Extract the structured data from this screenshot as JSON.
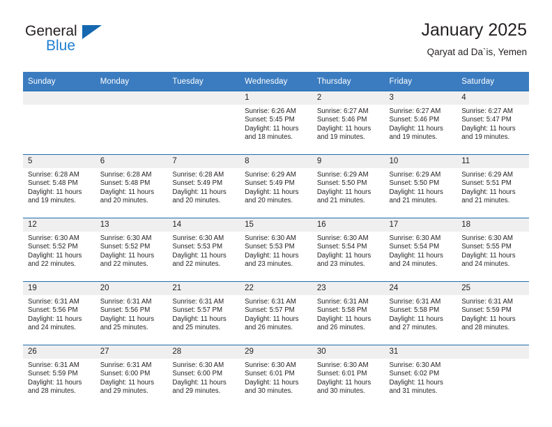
{
  "brand": {
    "name_top": "General",
    "name_bottom": "Blue",
    "flag_icon": "triangle-flag-icon",
    "accent_color": "#1567b0"
  },
  "header": {
    "title": "January 2025",
    "location": "Qaryat ad Da`is, Yemen"
  },
  "table": {
    "header_bg": "#3b7cc0",
    "row_divider_color": "#1f6cb0",
    "daynum_band_bg": "#efefef",
    "weekday_headers": [
      "Sunday",
      "Monday",
      "Tuesday",
      "Wednesday",
      "Thursday",
      "Friday",
      "Saturday"
    ],
    "labels": {
      "sunrise": "Sunrise:",
      "sunset": "Sunset:",
      "daylight": "Daylight:"
    },
    "weeks": [
      [
        {
          "day": "",
          "blank": true
        },
        {
          "day": "",
          "blank": true
        },
        {
          "day": "",
          "blank": true
        },
        {
          "day": "1",
          "sunrise": "Sunrise: 6:26 AM",
          "sunset": "Sunset: 5:45 PM",
          "daylight_line1": "Daylight: 11 hours",
          "daylight_line2": "and 18 minutes."
        },
        {
          "day": "2",
          "sunrise": "Sunrise: 6:27 AM",
          "sunset": "Sunset: 5:46 PM",
          "daylight_line1": "Daylight: 11 hours",
          "daylight_line2": "and 19 minutes."
        },
        {
          "day": "3",
          "sunrise": "Sunrise: 6:27 AM",
          "sunset": "Sunset: 5:46 PM",
          "daylight_line1": "Daylight: 11 hours",
          "daylight_line2": "and 19 minutes."
        },
        {
          "day": "4",
          "sunrise": "Sunrise: 6:27 AM",
          "sunset": "Sunset: 5:47 PM",
          "daylight_line1": "Daylight: 11 hours",
          "daylight_line2": "and 19 minutes."
        }
      ],
      [
        {
          "day": "5",
          "sunrise": "Sunrise: 6:28 AM",
          "sunset": "Sunset: 5:48 PM",
          "daylight_line1": "Daylight: 11 hours",
          "daylight_line2": "and 19 minutes."
        },
        {
          "day": "6",
          "sunrise": "Sunrise: 6:28 AM",
          "sunset": "Sunset: 5:48 PM",
          "daylight_line1": "Daylight: 11 hours",
          "daylight_line2": "and 20 minutes."
        },
        {
          "day": "7",
          "sunrise": "Sunrise: 6:28 AM",
          "sunset": "Sunset: 5:49 PM",
          "daylight_line1": "Daylight: 11 hours",
          "daylight_line2": "and 20 minutes."
        },
        {
          "day": "8",
          "sunrise": "Sunrise: 6:29 AM",
          "sunset": "Sunset: 5:49 PM",
          "daylight_line1": "Daylight: 11 hours",
          "daylight_line2": "and 20 minutes."
        },
        {
          "day": "9",
          "sunrise": "Sunrise: 6:29 AM",
          "sunset": "Sunset: 5:50 PM",
          "daylight_line1": "Daylight: 11 hours",
          "daylight_line2": "and 21 minutes."
        },
        {
          "day": "10",
          "sunrise": "Sunrise: 6:29 AM",
          "sunset": "Sunset: 5:50 PM",
          "daylight_line1": "Daylight: 11 hours",
          "daylight_line2": "and 21 minutes."
        },
        {
          "day": "11",
          "sunrise": "Sunrise: 6:29 AM",
          "sunset": "Sunset: 5:51 PM",
          "daylight_line1": "Daylight: 11 hours",
          "daylight_line2": "and 21 minutes."
        }
      ],
      [
        {
          "day": "12",
          "sunrise": "Sunrise: 6:30 AM",
          "sunset": "Sunset: 5:52 PM",
          "daylight_line1": "Daylight: 11 hours",
          "daylight_line2": "and 22 minutes."
        },
        {
          "day": "13",
          "sunrise": "Sunrise: 6:30 AM",
          "sunset": "Sunset: 5:52 PM",
          "daylight_line1": "Daylight: 11 hours",
          "daylight_line2": "and 22 minutes."
        },
        {
          "day": "14",
          "sunrise": "Sunrise: 6:30 AM",
          "sunset": "Sunset: 5:53 PM",
          "daylight_line1": "Daylight: 11 hours",
          "daylight_line2": "and 22 minutes."
        },
        {
          "day": "15",
          "sunrise": "Sunrise: 6:30 AM",
          "sunset": "Sunset: 5:53 PM",
          "daylight_line1": "Daylight: 11 hours",
          "daylight_line2": "and 23 minutes."
        },
        {
          "day": "16",
          "sunrise": "Sunrise: 6:30 AM",
          "sunset": "Sunset: 5:54 PM",
          "daylight_line1": "Daylight: 11 hours",
          "daylight_line2": "and 23 minutes."
        },
        {
          "day": "17",
          "sunrise": "Sunrise: 6:30 AM",
          "sunset": "Sunset: 5:54 PM",
          "daylight_line1": "Daylight: 11 hours",
          "daylight_line2": "and 24 minutes."
        },
        {
          "day": "18",
          "sunrise": "Sunrise: 6:30 AM",
          "sunset": "Sunset: 5:55 PM",
          "daylight_line1": "Daylight: 11 hours",
          "daylight_line2": "and 24 minutes."
        }
      ],
      [
        {
          "day": "19",
          "sunrise": "Sunrise: 6:31 AM",
          "sunset": "Sunset: 5:56 PM",
          "daylight_line1": "Daylight: 11 hours",
          "daylight_line2": "and 24 minutes."
        },
        {
          "day": "20",
          "sunrise": "Sunrise: 6:31 AM",
          "sunset": "Sunset: 5:56 PM",
          "daylight_line1": "Daylight: 11 hours",
          "daylight_line2": "and 25 minutes."
        },
        {
          "day": "21",
          "sunrise": "Sunrise: 6:31 AM",
          "sunset": "Sunset: 5:57 PM",
          "daylight_line1": "Daylight: 11 hours",
          "daylight_line2": "and 25 minutes."
        },
        {
          "day": "22",
          "sunrise": "Sunrise: 6:31 AM",
          "sunset": "Sunset: 5:57 PM",
          "daylight_line1": "Daylight: 11 hours",
          "daylight_line2": "and 26 minutes."
        },
        {
          "day": "23",
          "sunrise": "Sunrise: 6:31 AM",
          "sunset": "Sunset: 5:58 PM",
          "daylight_line1": "Daylight: 11 hours",
          "daylight_line2": "and 26 minutes."
        },
        {
          "day": "24",
          "sunrise": "Sunrise: 6:31 AM",
          "sunset": "Sunset: 5:58 PM",
          "daylight_line1": "Daylight: 11 hours",
          "daylight_line2": "and 27 minutes."
        },
        {
          "day": "25",
          "sunrise": "Sunrise: 6:31 AM",
          "sunset": "Sunset: 5:59 PM",
          "daylight_line1": "Daylight: 11 hours",
          "daylight_line2": "and 28 minutes."
        }
      ],
      [
        {
          "day": "26",
          "sunrise": "Sunrise: 6:31 AM",
          "sunset": "Sunset: 5:59 PM",
          "daylight_line1": "Daylight: 11 hours",
          "daylight_line2": "and 28 minutes."
        },
        {
          "day": "27",
          "sunrise": "Sunrise: 6:31 AM",
          "sunset": "Sunset: 6:00 PM",
          "daylight_line1": "Daylight: 11 hours",
          "daylight_line2": "and 29 minutes."
        },
        {
          "day": "28",
          "sunrise": "Sunrise: 6:30 AM",
          "sunset": "Sunset: 6:00 PM",
          "daylight_line1": "Daylight: 11 hours",
          "daylight_line2": "and 29 minutes."
        },
        {
          "day": "29",
          "sunrise": "Sunrise: 6:30 AM",
          "sunset": "Sunset: 6:01 PM",
          "daylight_line1": "Daylight: 11 hours",
          "daylight_line2": "and 30 minutes."
        },
        {
          "day": "30",
          "sunrise": "Sunrise: 6:30 AM",
          "sunset": "Sunset: 6:01 PM",
          "daylight_line1": "Daylight: 11 hours",
          "daylight_line2": "and 30 minutes."
        },
        {
          "day": "31",
          "sunrise": "Sunrise: 6:30 AM",
          "sunset": "Sunset: 6:02 PM",
          "daylight_line1": "Daylight: 11 hours",
          "daylight_line2": "and 31 minutes."
        },
        {
          "day": "",
          "blank": true
        }
      ]
    ]
  }
}
